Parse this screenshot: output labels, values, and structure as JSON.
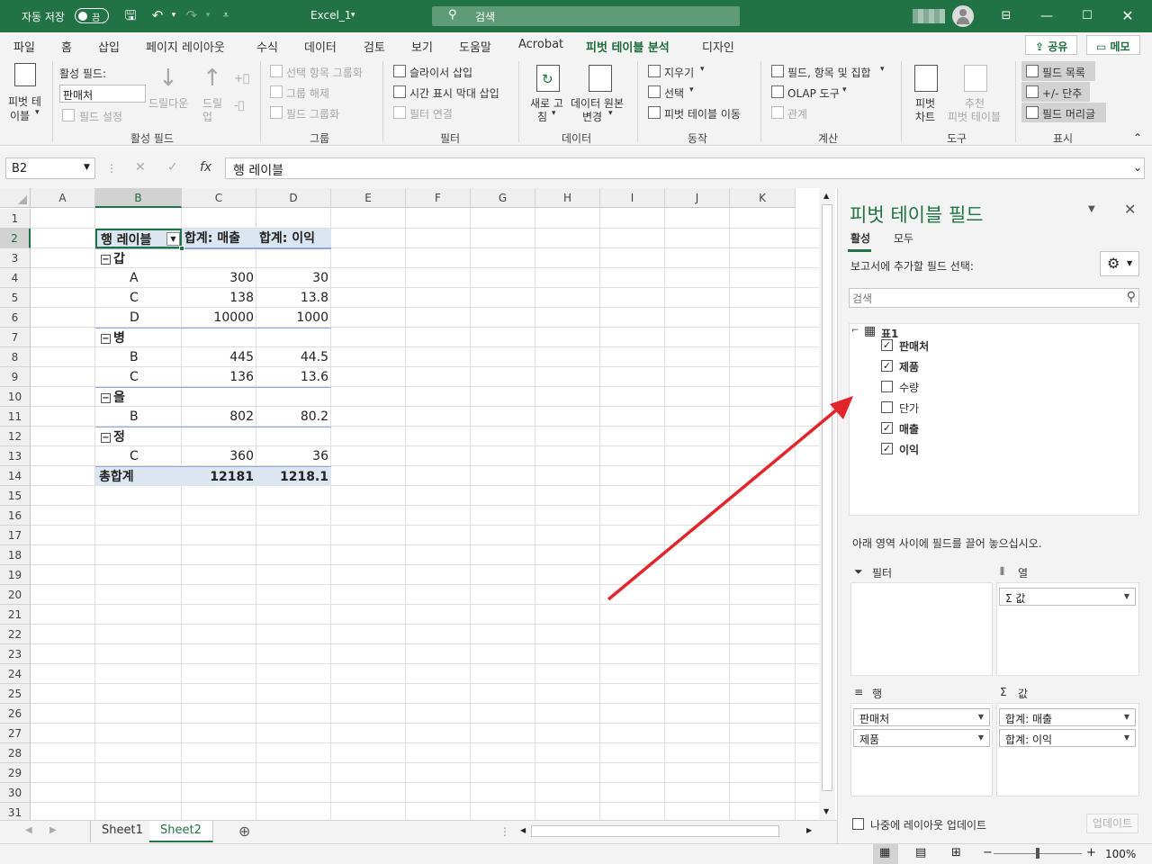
{
  "titlebar": {
    "autosave_label": "자동 저장",
    "autosave_state": "끔",
    "filename": "Excel_1",
    "search_placeholder": "검색"
  },
  "menu": {
    "items": [
      "파일",
      "홈",
      "삽입",
      "페이지 레이아웃",
      "수식",
      "데이터",
      "검토",
      "보기",
      "도움말",
      "Acrobat",
      "피벗 테이블 분석",
      "디자인"
    ],
    "share": "공유",
    "memo": "메모"
  },
  "ribbon": {
    "pivot_table_line1": "피벗 테",
    "pivot_table_line2": "이블",
    "active_field_label": "활성 필드:",
    "active_field_value": "판매처",
    "field_settings": "필드 설정",
    "drill_down": "드릴다운",
    "drill_up_line1": "드릴",
    "drill_up_line2": "업",
    "group_active_field": "활성 필드",
    "group_selection": "선택 항목 그룹화",
    "ungroup": "그룹 해제",
    "group_field": "필드 그룹화",
    "group_group": "그룹",
    "insert_slicer": "슬라이서 삽입",
    "insert_timeline": "시간 표시 막대 삽입",
    "filter_connections": "필터 연결",
    "group_filter": "필터",
    "refresh_line1": "새로 고",
    "refresh_line2": "침",
    "change_source_line1": "데이터 원본",
    "change_source_line2": "변경",
    "group_data": "데이터",
    "clear": "지우기",
    "select": "선택",
    "move_pivot": "피벗 테이블 이동",
    "group_actions": "동작",
    "fields_items_sets": "필드, 항목 및 집합",
    "olap_tools": "OLAP 도구",
    "relationships": "관계",
    "group_calculations": "계산",
    "pivot_chart_line1": "피벗",
    "pivot_chart_line2": "차트",
    "recommended_line1": "추천",
    "recommended_line2": "피벗 테이블",
    "group_tools": "도구",
    "field_list": "필드 목록",
    "plus_minus_buttons": "+/- 단추",
    "field_headers": "필드 머리글",
    "group_show": "표시"
  },
  "formula_bar": {
    "name_box": "B2",
    "formula": "행 레이블"
  },
  "grid": {
    "columns": [
      "A",
      "B",
      "C",
      "D",
      "E",
      "F",
      "G",
      "H",
      "I",
      "J",
      "K"
    ],
    "rows": [
      "1",
      "2",
      "3",
      "4",
      "5",
      "6",
      "7",
      "8",
      "9",
      "10",
      "11",
      "12",
      "13",
      "14",
      "15",
      "16",
      "17",
      "18",
      "19",
      "20",
      "21",
      "22",
      "23",
      "24",
      "25",
      "26",
      "27",
      "28",
      "29",
      "30",
      "31"
    ],
    "pivot_headers": [
      "행 레이블",
      "합계: 매출",
      "합계: 이익"
    ],
    "pivot_rows": [
      {
        "label": "갑",
        "type": "group"
      },
      {
        "label": "A",
        "sales": "300",
        "profit": "30",
        "type": "item"
      },
      {
        "label": "C",
        "sales": "138",
        "profit": "13.8",
        "type": "item"
      },
      {
        "label": "D",
        "sales": "10000",
        "profit": "1000",
        "type": "item"
      },
      {
        "label": "병",
        "type": "group"
      },
      {
        "label": "B",
        "sales": "445",
        "profit": "44.5",
        "type": "item"
      },
      {
        "label": "C",
        "sales": "136",
        "profit": "13.6",
        "type": "item"
      },
      {
        "label": "을",
        "type": "group"
      },
      {
        "label": "B",
        "sales": "802",
        "profit": "80.2",
        "type": "item"
      },
      {
        "label": "정",
        "type": "group"
      },
      {
        "label": "C",
        "sales": "360",
        "profit": "36",
        "type": "item"
      },
      {
        "label": "총합계",
        "sales": "12181",
        "profit": "1218.1",
        "type": "total"
      }
    ]
  },
  "sheets": [
    "Sheet1",
    "Sheet2"
  ],
  "active_sheet": "Sheet2",
  "pane": {
    "title": "피벗 테이블 필드",
    "tab_active": "활성",
    "tab_all": "모두",
    "choose_label": "보고서에 추가할 필드 선택:",
    "search_placeholder": "검색",
    "table_name": "표1",
    "fields": [
      {
        "name": "판매처",
        "checked": true
      },
      {
        "name": "제품",
        "checked": true
      },
      {
        "name": "수량",
        "checked": false
      },
      {
        "name": "단가",
        "checked": false
      },
      {
        "name": "매출",
        "checked": true
      },
      {
        "name": "이익",
        "checked": true
      }
    ],
    "drag_hint": "아래 영역 사이에 필드를 끌어 놓으십시오.",
    "area_filter": "필터",
    "area_columns": "열",
    "area_rows": "행",
    "area_values": "값",
    "columns_items": [
      "Σ 값"
    ],
    "rows_items": [
      "판매처",
      "제품"
    ],
    "values_items": [
      "합계: 매출",
      "합계: 이익"
    ],
    "defer_update": "나중에 레이아웃 업데이트",
    "update_button": "업데이트"
  },
  "status": {
    "zoom": "100%"
  },
  "annotation_color": "#e0262b"
}
